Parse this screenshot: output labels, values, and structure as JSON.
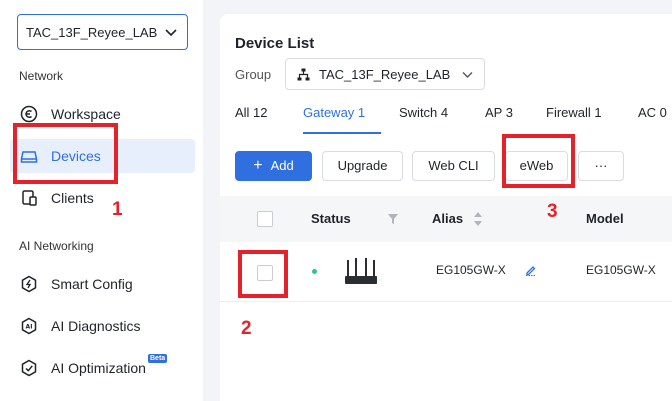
{
  "sidebar": {
    "network_select": "TAC_13F_Reyee_LAB",
    "section_network": "Network",
    "section_ai": "AI Networking",
    "items": [
      {
        "label": "Workspace",
        "icon": "workspace-icon"
      },
      {
        "label": "Devices",
        "icon": "devices-icon",
        "active": true
      },
      {
        "label": "Clients",
        "icon": "clients-icon"
      },
      {
        "label": "Smart Config",
        "icon": "smart-config-icon"
      },
      {
        "label": "AI Diagnostics",
        "icon": "ai-diagnostics-icon"
      },
      {
        "label": "AI Optimization",
        "icon": "ai-optimization-icon",
        "badge": "Beta"
      }
    ]
  },
  "main": {
    "title": "Device List",
    "group_label": "Group",
    "group_value": "TAC_13F_Reyee_LAB",
    "tabs": [
      {
        "label": "All 12"
      },
      {
        "label": "Gateway 1",
        "active": true
      },
      {
        "label": "Switch 4"
      },
      {
        "label": "AP 3"
      },
      {
        "label": "Firewall 1"
      },
      {
        "label": "AC 0"
      }
    ],
    "buttons": {
      "add": "Add",
      "add_icon": "+",
      "upgrade": "Upgrade",
      "webcli": "Web CLI",
      "eweb": "eWeb",
      "more": "···"
    },
    "table": {
      "headers": {
        "status": "Status",
        "alias": "Alias",
        "model": "Model"
      },
      "rows": [
        {
          "alias": "EG105GW-X",
          "model": "EG105GW-X",
          "status": "online"
        }
      ]
    }
  },
  "annotations": [
    "1",
    "2",
    "3"
  ],
  "colors": {
    "accent": "#2f6fe0",
    "annotation": "#e3222b",
    "online": "#31c48d"
  }
}
